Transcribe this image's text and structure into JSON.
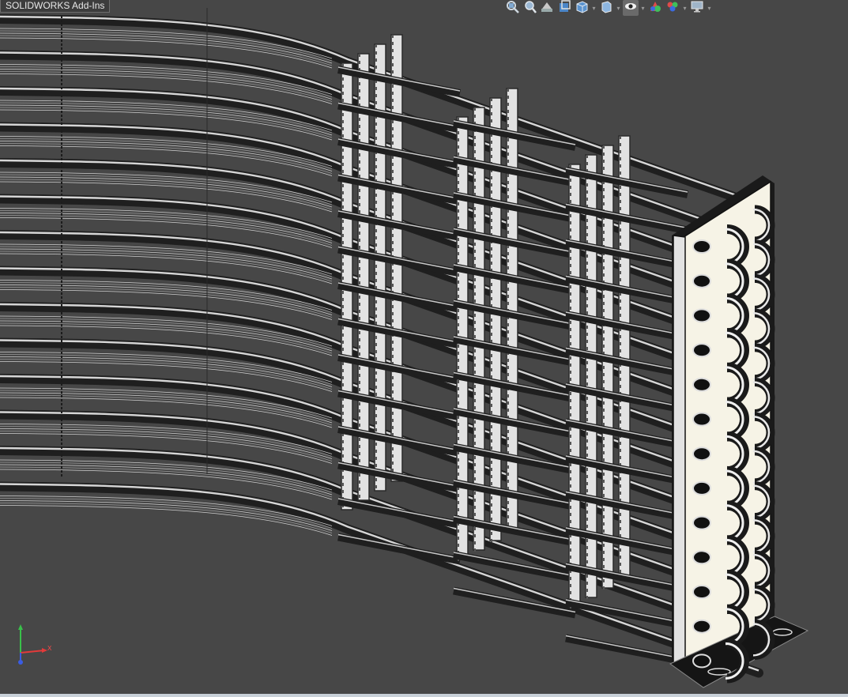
{
  "app": {
    "name": "SOLIDWORKS"
  },
  "command_tab": {
    "label": "SOLIDWORKS Add-Ins"
  },
  "heads_up_toolbar": [
    {
      "icon": "zoom-to-fit-icon",
      "dropdown": false
    },
    {
      "icon": "zoom-to-area-icon",
      "dropdown": false
    },
    {
      "icon": "previous-view-icon",
      "dropdown": false
    },
    {
      "icon": "section-view-icon",
      "dropdown": false
    },
    {
      "icon": "view-orientation-icon",
      "dropdown": true
    },
    {
      "icon": "display-style-icon",
      "dropdown": true
    },
    {
      "icon": "hide-show-items-icon",
      "dropdown": true,
      "active": true
    },
    {
      "icon": "edit-appearance-icon",
      "dropdown": false
    },
    {
      "icon": "apply-scene-icon",
      "dropdown": true
    },
    {
      "icon": "view-settings-icon",
      "dropdown": true
    }
  ],
  "triad": {
    "x_label": "X",
    "y_label": "Y",
    "z_label": "Z"
  },
  "colors": {
    "background": "#474747",
    "tube_dark": "#1f1f1f",
    "tube_highlight": "#d6d6d6",
    "plate_light": "#e2e2e2",
    "plate_inner": "#f6f3e6",
    "base_plate": "#151515"
  }
}
